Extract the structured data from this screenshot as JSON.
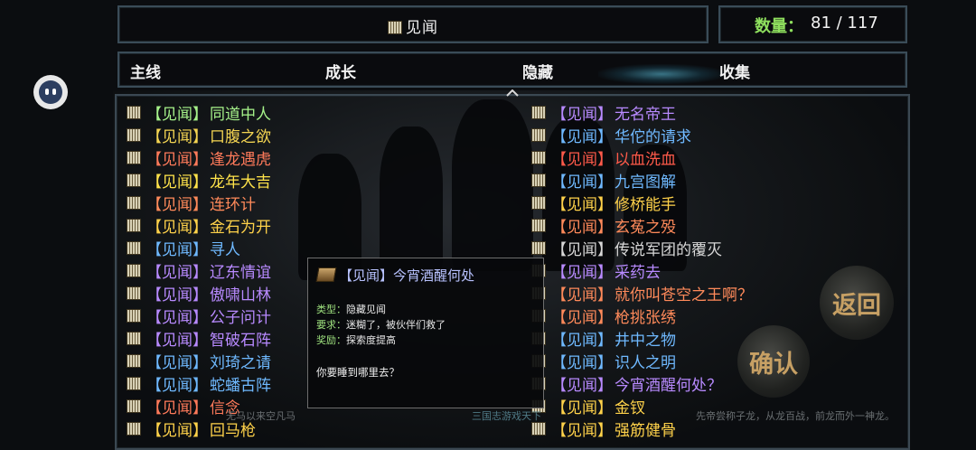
{
  "header": {
    "title": "见闻",
    "count_label": "数量：",
    "count_value": "81 / 117"
  },
  "tabs": [
    {
      "label": "主线",
      "active": false
    },
    {
      "label": "成长",
      "active": false
    },
    {
      "label": "隐藏",
      "active": true
    },
    {
      "label": "收集",
      "active": false
    }
  ],
  "tag_text": "【见闻】",
  "left_list": [
    {
      "name": "同道中人",
      "color": "#a6f28a"
    },
    {
      "name": "口腹之欲",
      "color": "#f4d552"
    },
    {
      "name": "逢龙遇虎",
      "color": "#ff7a5a"
    },
    {
      "name": "龙年大吉",
      "color": "#ffe34a"
    },
    {
      "name": "连环计",
      "color": "#ff8a5a"
    },
    {
      "name": "金石为开",
      "color": "#ffd24a"
    },
    {
      "name": "寻人",
      "color": "#6fb9ff"
    },
    {
      "name": "辽东情谊",
      "color": "#b88aff"
    },
    {
      "name": "傲啸山林",
      "color": "#b88aff"
    },
    {
      "name": "公子问计",
      "color": "#b88aff"
    },
    {
      "name": "智破石阵",
      "color": "#b88aff"
    },
    {
      "name": "刘琦之请",
      "color": "#6fb9ff"
    },
    {
      "name": "蛇蟠古阵",
      "color": "#6fb9ff"
    },
    {
      "name": "信念",
      "color": "#ff7a5a"
    },
    {
      "name": "回马枪",
      "color": "#ffd24a"
    }
  ],
  "right_list": [
    {
      "name": "无名帝王",
      "color": "#b88aff"
    },
    {
      "name": "华佗的请求",
      "color": "#6fb9ff"
    },
    {
      "name": "以血洗血",
      "color": "#ff5a4a"
    },
    {
      "name": "九宫图解",
      "color": "#6fb9ff"
    },
    {
      "name": "修桥能手",
      "color": "#ffd24a"
    },
    {
      "name": "玄菟之殁",
      "color": "#ff8a5a"
    },
    {
      "name": "传说军团的覆灭",
      "color": "#d8d8d8"
    },
    {
      "name": "采药去",
      "color": "#b88aff"
    },
    {
      "name": "就你叫苍空之王啊？",
      "color": "#ff8a5a"
    },
    {
      "name": "枪挑张绣",
      "color": "#ff8a5a"
    },
    {
      "name": "井中之物",
      "color": "#6fb9ff"
    },
    {
      "name": "识人之明",
      "color": "#6fb9ff"
    },
    {
      "name": "今宵酒醒何处？",
      "color": "#b88aff"
    },
    {
      "name": "金钗",
      "color": "#ffd24a"
    },
    {
      "name": "强筋健骨",
      "color": "#ffd24a"
    }
  ],
  "detail": {
    "title": "【见闻】今宵酒醒何处",
    "type_key": "类型：",
    "type_val": "隐藏见闻",
    "req_key": "要求：",
    "req_val": "迷糊了，被伙伴们救了",
    "reward_key": "奖励：",
    "reward_val": "探索度提高",
    "question": "你要睡到哪里去？"
  },
  "bottom_center_text": "三国志游戏天下",
  "bottom_left_text": "无马以来空凡马",
  "bottom_right_text": "先帝尝称子龙，从龙百战，前龙而外一神龙。",
  "buttons": {
    "return": "返回",
    "confirm": "确认"
  }
}
